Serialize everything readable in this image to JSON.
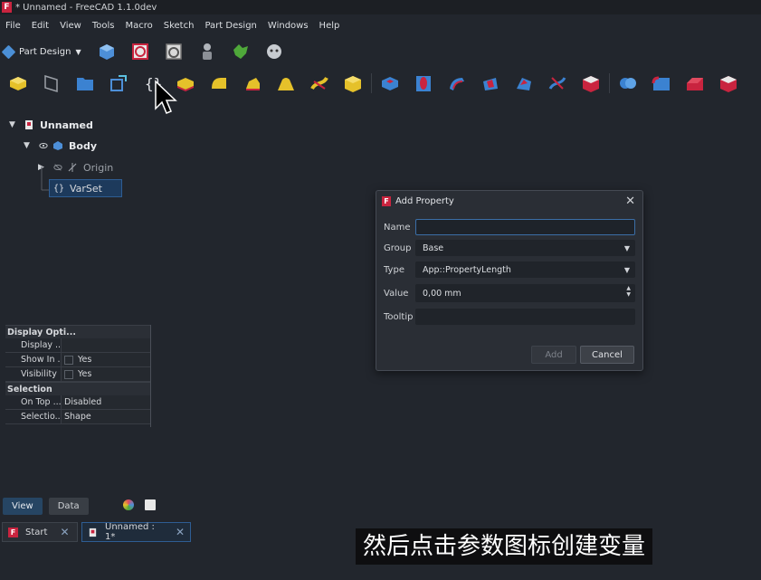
{
  "window": {
    "title": "* Unnamed - FreeCAD 1.1.0dev",
    "logo": "F"
  },
  "menu": [
    "File",
    "Edit",
    "View",
    "Tools",
    "Macro",
    "Sketch",
    "Part Design",
    "Windows",
    "Help"
  ],
  "workbench": {
    "label": "Part Design"
  },
  "toolbar1_icons": [
    "part-icon",
    "sketch-validate-icon",
    "sketch-check-icon",
    "robot-icon",
    "macro-icon",
    "assistant-icon"
  ],
  "toolbar2_icons": [
    "body-icon",
    "sketch-icon",
    "group-icon",
    "shape-binder-icon",
    "varset-icon",
    "pad-icon",
    "revolution-icon",
    "loft-icon",
    "pipe-icon",
    "helix-icon",
    "additive-primitive-icon",
    "pocket-icon",
    "hole-icon",
    "groove-icon",
    "subtractive-loft-icon",
    "subtractive-pipe-icon",
    "subtractive-helix-icon",
    "subtractive-primitive-icon",
    "boolean-icon",
    "fillet-icon",
    "chamfer-icon",
    "draft-icon"
  ],
  "tree": {
    "root": "Unnamed",
    "body": "Body",
    "origin": "Origin",
    "varset": "VarSet",
    "varset_icon": "{}"
  },
  "properties": {
    "groups": [
      {
        "name": "Display Opti...",
        "rows": [
          {
            "name": "Display ...",
            "value": ""
          },
          {
            "name": "Show In ...",
            "value": "Yes",
            "checkbox": true
          },
          {
            "name": "Visibility",
            "value": "Yes",
            "checkbox": true
          }
        ]
      },
      {
        "name": "Selection",
        "rows": [
          {
            "name": "On Top ...",
            "value": "Disabled"
          },
          {
            "name": "Selectio...",
            "value": "Shape"
          }
        ]
      }
    ]
  },
  "panel_tabs": {
    "view": "View",
    "data": "Data"
  },
  "doc_tabs": [
    {
      "label": "Start",
      "close": "✕"
    },
    {
      "label": "Unnamed : 1*",
      "close": "✕"
    }
  ],
  "dialog": {
    "title": "Add Property",
    "close": "✕",
    "name_label": "Name",
    "name_value": "",
    "group_label": "Group",
    "group_value": "Base",
    "type_label": "Type",
    "type_value": "App::PropertyLength",
    "value_label": "Value",
    "value_value": "0,00 mm",
    "tooltip_label": "Tooltip",
    "tooltip_value": "",
    "add_button": "Add",
    "cancel_button": "Cancel"
  },
  "subtitle": "然后点击参数图标创建变量",
  "colors": {
    "accent": "#2e5d93",
    "brand": "#c9243f",
    "background": "#22262d"
  }
}
